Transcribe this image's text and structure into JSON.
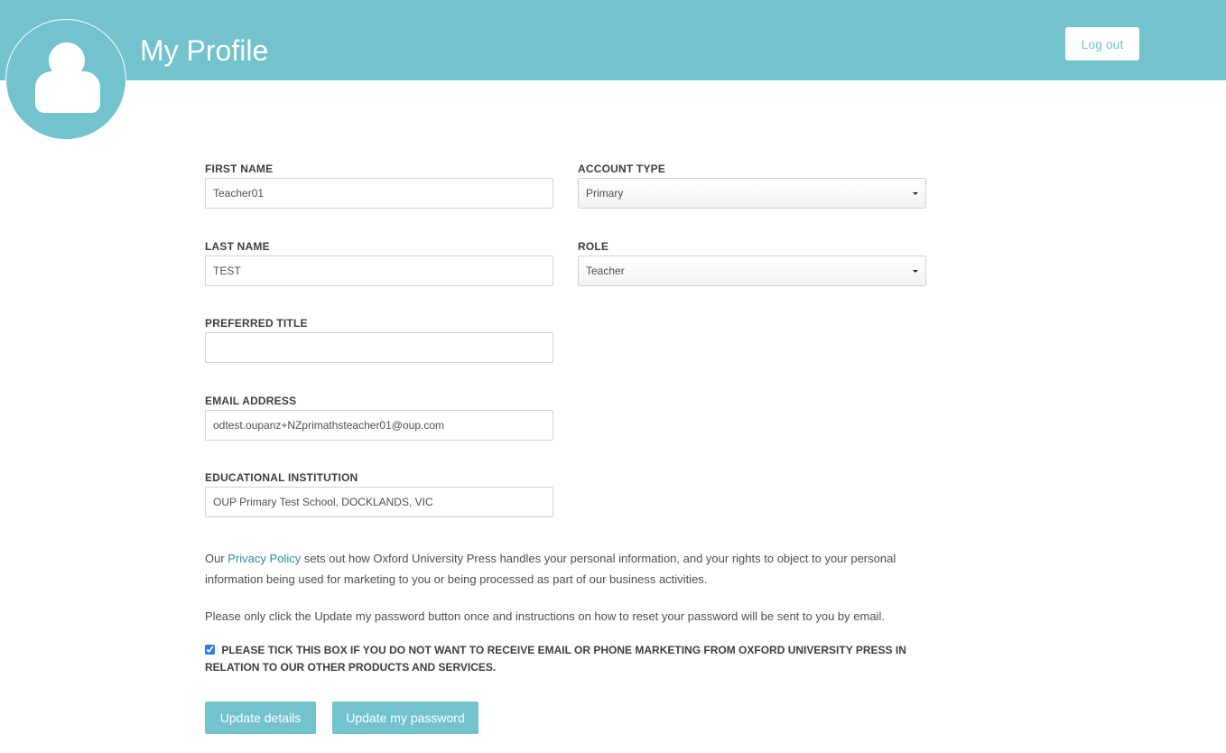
{
  "header": {
    "title": "My Profile",
    "logout_label": "Log out",
    "accent_color": "#72c3ce"
  },
  "avatar": {
    "icon": "user-icon"
  },
  "form": {
    "first_name": {
      "label": "FIRST NAME",
      "value": "Teacher01"
    },
    "last_name": {
      "label": "LAST NAME",
      "value": "TEST"
    },
    "preferred_title": {
      "label": "PREFERRED TITLE",
      "value": ""
    },
    "email": {
      "label": "EMAIL ADDRESS",
      "value": "odtest.oupanz+NZprimathsteacher01@oup.com"
    },
    "institution": {
      "label": "EDUCATIONAL INSTITUTION",
      "value": "OUP Primary Test School, DOCKLANDS, VIC"
    },
    "account_type": {
      "label": "ACCOUNT TYPE",
      "value": "Primary"
    },
    "role": {
      "label": "ROLE",
      "value": "Teacher"
    }
  },
  "privacy": {
    "prefix": "Our ",
    "link": "Privacy Policy",
    "suffix": " sets out how Oxford University Press handles your personal information, and your rights to object to your personal information being used for marketing to you or being processed as part of our business activities."
  },
  "password_note": "Please only click the Update my password button once and instructions on how to reset your password will be sent to you by email.",
  "marketing_optout": {
    "label": "PLEASE TICK THIS BOX IF YOU DO NOT WANT TO RECEIVE EMAIL OR PHONE MARKETING FROM OXFORD UNIVERSITY PRESS IN RELATION TO OUR OTHER PRODUCTS AND SERVICES.",
    "checked": true
  },
  "buttons": {
    "update_details": "Update details",
    "update_password": "Update my password"
  }
}
